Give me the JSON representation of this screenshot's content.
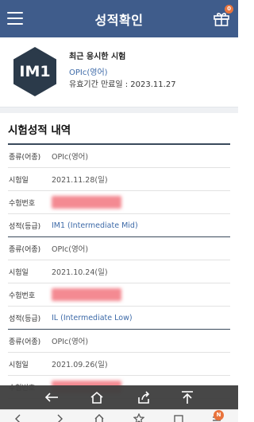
{
  "header": {
    "title": "성적확인",
    "gift_badge": "0"
  },
  "profile": {
    "level_badge": "IM1",
    "heading": "최근 응시한 시험",
    "test_name": "OPIc(영어)",
    "expiry": "유효기간 만료일 : 2023.11.27"
  },
  "section_title": "시험성적 내역",
  "labels": {
    "type": "종류(어종)",
    "date": "시험일",
    "id": "수험번호",
    "grade": "성적(등급)"
  },
  "records": [
    {
      "type": "OPIc(영어)",
      "date": "2021.11.28(일)",
      "grade": "IM1 (Intermediate Mid)"
    },
    {
      "type": "OPIc(영어)",
      "date": "2021.10.24(일)",
      "grade": "IL (Intermediate Low)"
    },
    {
      "type": "OPIc(영어)",
      "date": "2021.09.26(일)"
    }
  ],
  "nav_badge": "N",
  "colors": {
    "header": "#3f5c8b",
    "accent_text": "#3d6aa8",
    "badge": "#e9743d",
    "hexagon": "#2b3a4a"
  }
}
